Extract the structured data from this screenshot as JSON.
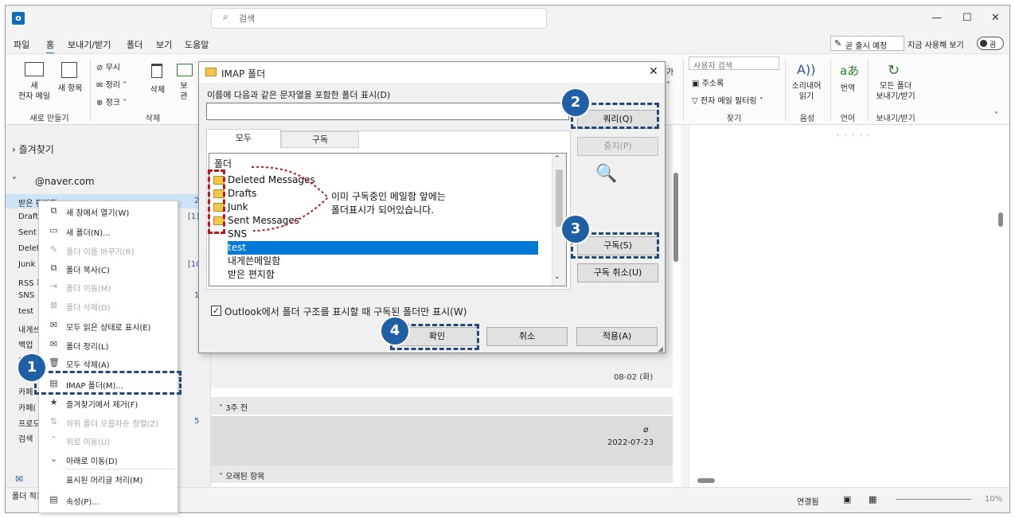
{
  "titlebar": {
    "search_placeholder": "검색",
    "minimize": "—",
    "maximize": "☐",
    "close": "✕"
  },
  "menu": {
    "items": [
      "파일",
      "홈",
      "보내기/받기",
      "폴더",
      "보기",
      "도움말"
    ],
    "coming_soon": "곧 출시 예정",
    "try_now": "지금 사용해 보기",
    "toggle": "끔"
  },
  "ribbon": {
    "new_email": "새\n전자 메일",
    "new_items": "새 항목",
    "group_new": "새로 만들기",
    "ignore": "무시",
    "cleanup": "정리",
    "junk": "정크",
    "delete": "삭제",
    "archive": "보\n관",
    "group_delete": "삭제",
    "search_people": "사용자 검색",
    "address_book": "주소록",
    "filter_email": "전자 메일 필터링",
    "group_find": "찾기",
    "read_aloud": "소리내어\n읽기",
    "group_voice": "음성",
    "translate": "번역",
    "group_language": "언어",
    "send_receive_all": "모든 폴더\n보내기/받기",
    "group_send_receive": "보내기/받기"
  },
  "leftpane": {
    "favorites": "즐겨찾기",
    "account": "@naver.com",
    "folders": [
      {
        "name": "받은 편지함",
        "count": "2"
      },
      {
        "name": "Drafts",
        "count": "[1]"
      },
      {
        "name": "Sent I",
        "count": ""
      },
      {
        "name": "Delete",
        "count": ""
      },
      {
        "name": "Junk",
        "count": "[10]"
      },
      {
        "name": "RSS 피",
        "count": ""
      },
      {
        "name": "SNS",
        "count": "18"
      },
      {
        "name": "test",
        "count": ""
      },
      {
        "name": "내게쓰",
        "count": ""
      },
      {
        "name": "백업",
        "count": ""
      },
      {
        "name": "보낸",
        "count": ""
      },
      {
        "name": "카페",
        "count": ""
      },
      {
        "name": "카페(",
        "count": ""
      },
      {
        "name": "프로모",
        "count": "5"
      },
      {
        "name": "검색",
        "count": ""
      }
    ]
  },
  "context_menu": {
    "items": [
      {
        "label": "새 창에서 열기(W)",
        "icon": "new-window-icon",
        "disabled": false
      },
      {
        "label": "새 폴더(N)...",
        "icon": "new-folder-icon",
        "disabled": false
      },
      {
        "label": "폴더 이름 바꾸기(R)",
        "icon": "rename-icon",
        "disabled": true
      },
      {
        "label": "폴더 복사(C)",
        "icon": "copy-icon",
        "disabled": false
      },
      {
        "label": "폴더 이동(M)",
        "icon": "move-icon",
        "disabled": true
      },
      {
        "label": "폴더 삭제(D)",
        "icon": "delete-folder-icon",
        "disabled": true
      },
      {
        "label": "모두 읽은 상태로 표시(E)",
        "icon": "mark-read-icon",
        "disabled": false
      },
      {
        "label": "폴더 정리(L)",
        "icon": "cleanup-icon",
        "disabled": false
      },
      {
        "label": "모두 삭제(A)",
        "icon": "delete-all-icon",
        "disabled": false
      },
      {
        "label": "IMAP 폴더(M)...",
        "icon": "imap-icon",
        "disabled": false
      },
      {
        "label": "즐겨찾기에서 제거(F)",
        "icon": "favorite-icon",
        "disabled": false
      },
      {
        "label": "하위 폴더 오름차순 정렬(Z)",
        "icon": "sort-icon",
        "disabled": true
      },
      {
        "label": "위로 이동(U)",
        "icon": "chevron-up-icon",
        "disabled": true
      },
      {
        "label": "아래로 이동(D)",
        "icon": "chevron-down-icon",
        "disabled": false
      },
      {
        "label": "표시된 머리글 처리(M)",
        "icon": "",
        "disabled": false
      },
      {
        "label": "속성(P)...",
        "icon": "properties-icon",
        "disabled": false
      }
    ]
  },
  "maillist": {
    "date1": "08-02 (화)",
    "group_3weeks": "3주 전",
    "date2": "2022-07-23",
    "group_old": "오래된 항목"
  },
  "status": {
    "left": "폴더 적용",
    "connected": "연결됨",
    "zoom": "10%"
  },
  "dialog": {
    "title": "IMAP 폴더",
    "filter_label": "이름에 다음과 같은 문자열을 포함한 폴더 표시(D)",
    "filter_value": "",
    "tabs": [
      "모두",
      "구독"
    ],
    "list_header": "폴더",
    "folders": [
      "Deleted Messages",
      "Drafts",
      "Junk",
      "Sent Messages",
      "SNS",
      "test",
      "내게쓴메일함",
      "받은 편지함"
    ],
    "selected_index": 5,
    "btn_query": "쿼리(Q)",
    "btn_stop": "중지(P)",
    "btn_subscribe": "구독(S)",
    "btn_unsubscribe": "구독 취소(U)",
    "checkbox_label": "Outlook에서 폴더 구조를 표시할 때 구독된 폴더만 표시(W)",
    "checkbox_checked": true,
    "btn_ok": "확인",
    "btn_cancel": "취소",
    "btn_apply": "적용(A)"
  },
  "annotation": {
    "note_line1": "이미 구독중인 메일함 앞에는",
    "note_line2": "폴더표시가 되어있습니다.",
    "badges": [
      "1",
      "2",
      "3",
      "4"
    ],
    "highlight_color": "#24477a",
    "folder_mark_color": "#c0171c"
  }
}
